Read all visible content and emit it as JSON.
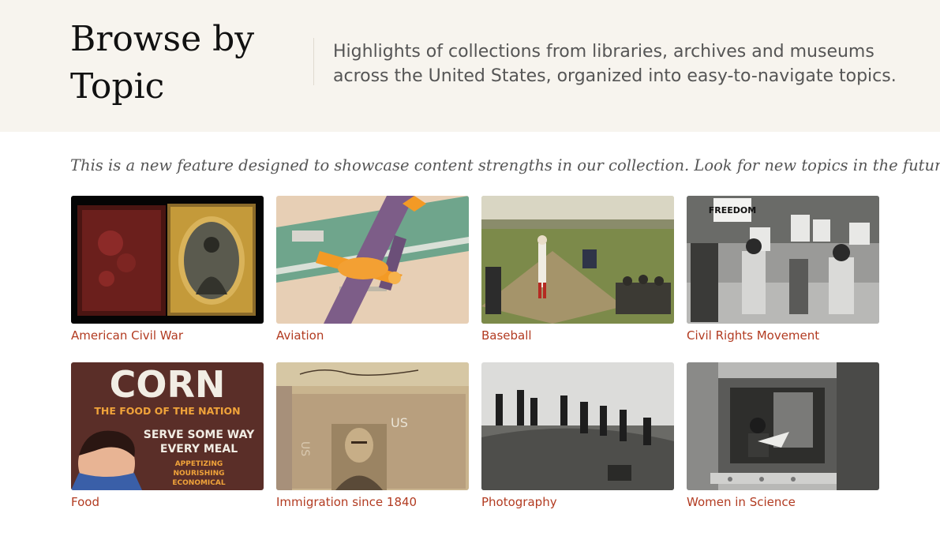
{
  "header": {
    "title": "Browse by Topic",
    "description": "Highlights of collections from libraries, archives and museums across the United States, organized into easy-to-navigate topics."
  },
  "intro": "This is a new feature designed to showcase content strengths in our collection. Look for new topics in the future!",
  "topics": [
    {
      "label": "American Civil War"
    },
    {
      "label": "Aviation"
    },
    {
      "label": "Baseball"
    },
    {
      "label": "Civil Rights Movement"
    },
    {
      "label": "Food",
      "image_text": {
        "line1": "CORN",
        "line2": "THE FOOD OF THE NATION",
        "line3": "SERVE SOME WAY",
        "line4": "EVERY MEAL",
        "line5": "APPETIZING",
        "line6": "NOURISHING",
        "line7": "ECONOMICAL"
      }
    },
    {
      "label": "Immigration since 1840",
      "image_text": {
        "us": "US"
      }
    },
    {
      "label": "Photography"
    },
    {
      "label": "Women in Science"
    }
  ],
  "civil_rights_signs": {
    "freedom": "FREEDOM"
  },
  "colors": {
    "link": "#b23b21",
    "hero_bg": "#f7f4ee"
  }
}
